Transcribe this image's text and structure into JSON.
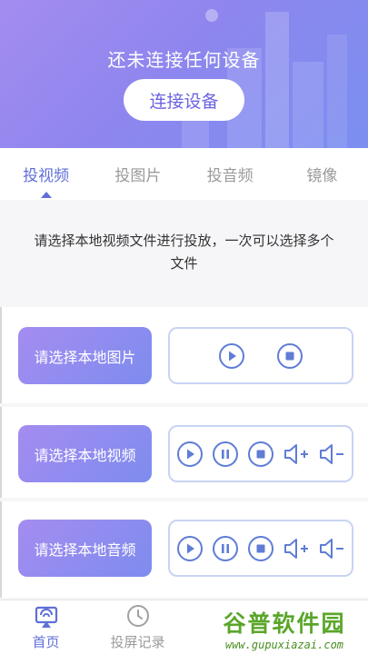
{
  "banner": {
    "title": "还未连接任何设备",
    "connect_label": "连接设备"
  },
  "tabs": [
    {
      "label": "投视频",
      "active": true
    },
    {
      "label": "投图片",
      "active": false
    },
    {
      "label": "投音频",
      "active": false
    },
    {
      "label": "镜像",
      "active": false
    }
  ],
  "hint": {
    "line1": "请选择本地视频文件进行投放，一次可以选择多个",
    "line2": "文件"
  },
  "rows": {
    "image": {
      "pick_label": "请选择本地图片",
      "controls": [
        "play-icon",
        "stop-icon"
      ]
    },
    "video": {
      "pick_label": "请选择本地视频",
      "controls": [
        "play-icon",
        "pause-icon",
        "stop-icon",
        "volume-up-icon",
        "volume-down-icon"
      ]
    },
    "audio": {
      "pick_label": "请选择本地音频",
      "controls": [
        "play-icon",
        "pause-icon",
        "stop-icon",
        "volume-up-icon",
        "volume-down-icon"
      ]
    }
  },
  "bottom_nav": [
    {
      "label": "首页",
      "icon": "cast-icon",
      "active": true
    },
    {
      "label": "投屏记录",
      "icon": "clock-icon",
      "active": false
    }
  ],
  "watermark": {
    "main": "谷普软件园",
    "url": "www.gupuxiazai.com"
  },
  "colors": {
    "accent": "#5f6fd8",
    "banner_start": "#a48cf0",
    "banner_end": "#7b8ff0",
    "control_border": "#c9d4f3"
  }
}
